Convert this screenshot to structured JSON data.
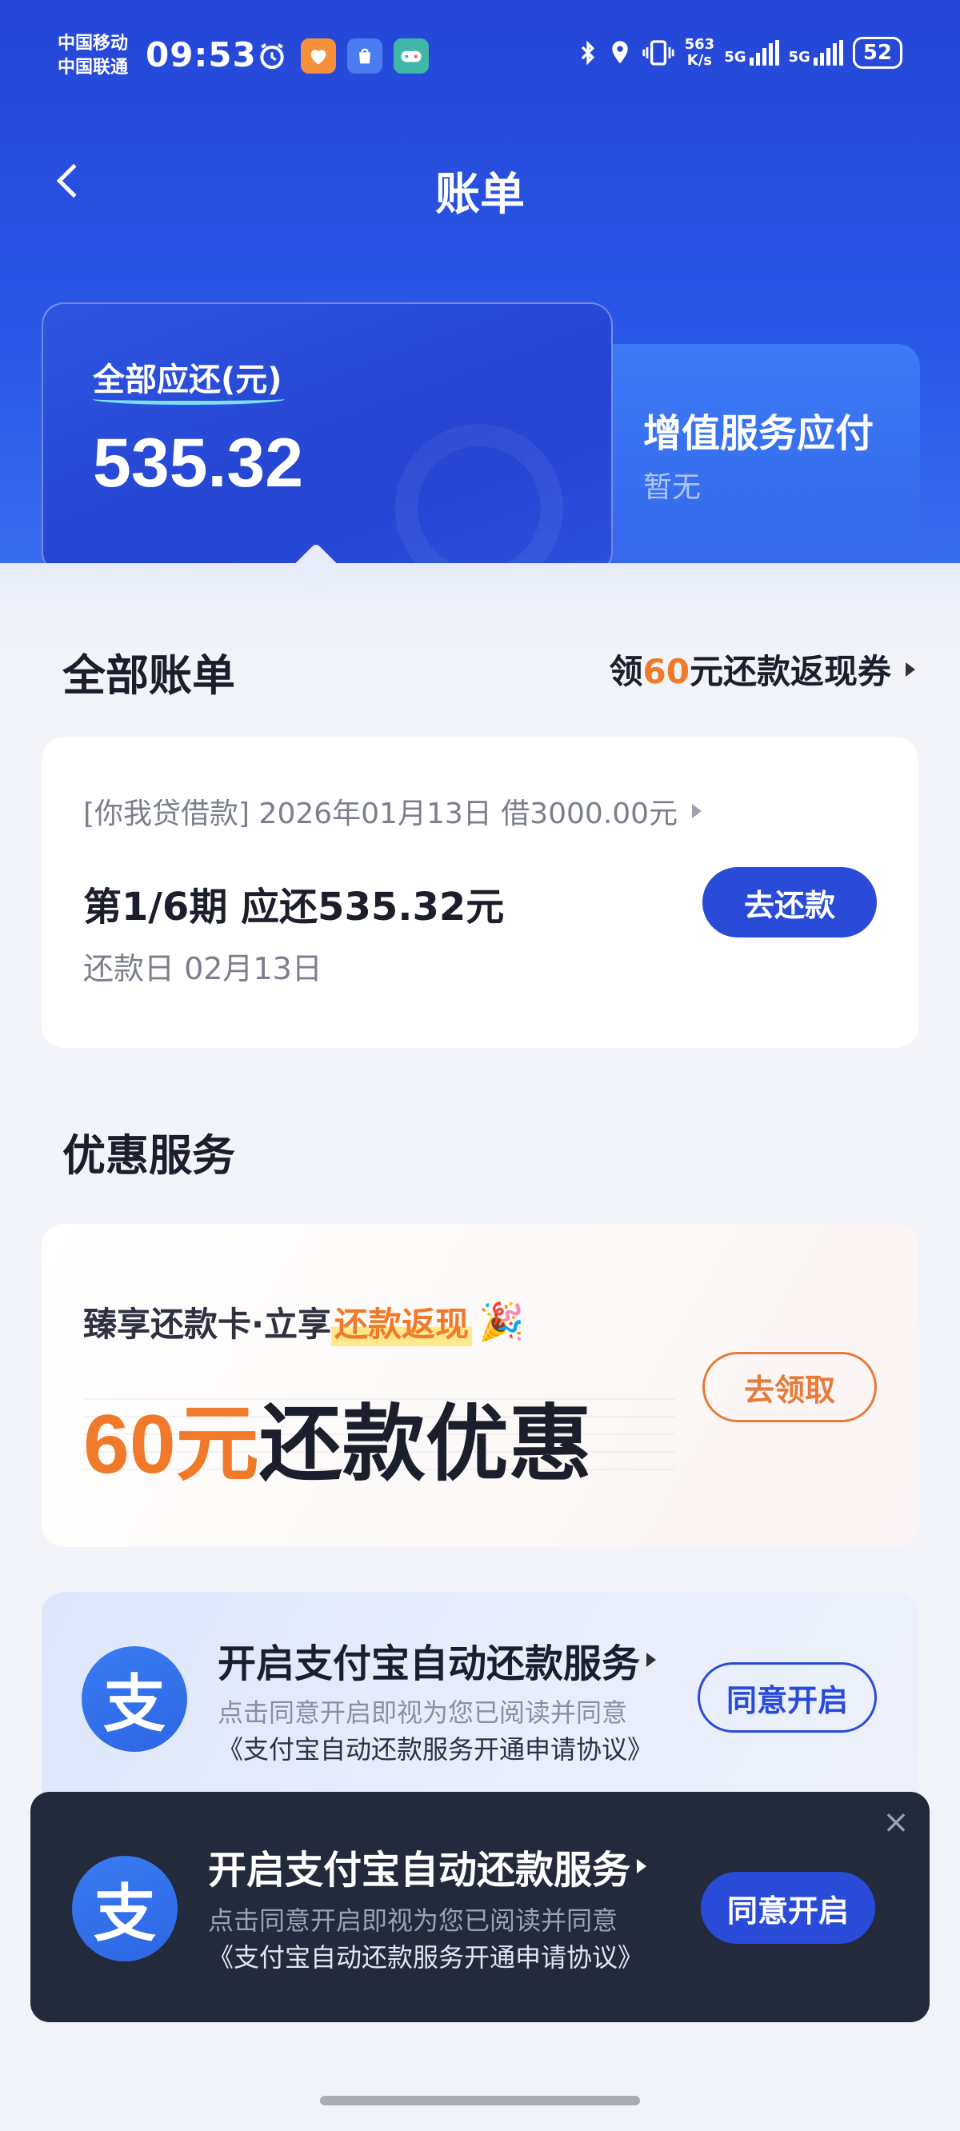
{
  "status_bar": {
    "carrier_1": "中国移动",
    "carrier_2": "中国联通",
    "time": "09:53",
    "net_speed_value": "563",
    "net_speed_unit": "K/s",
    "sig1_label": "5G",
    "sig2_label": "5G",
    "battery": "52"
  },
  "nav": {
    "title": "账单"
  },
  "summary": {
    "total_label": "全部应还(元)",
    "total_amount": "535.32",
    "vas_title": "增值服务应付",
    "vas_value": "暂无"
  },
  "bills_section": {
    "title": "全部账单",
    "promo_prefix": "领",
    "promo_amount": "60",
    "promo_suffix": "元还款返现券"
  },
  "bill": {
    "meta": "[你我贷借款] 2026年01月13日 借3000.00元",
    "period": "第1/6期 应还535.32元",
    "due_date": "还款日 02月13日",
    "repay_label": "去还款"
  },
  "discount_section": {
    "title": "优惠服务"
  },
  "discount": {
    "subtitle_prefix": "臻享还款卡·立享",
    "subtitle_highlight": "还款返现",
    "main_highlight": "60元",
    "main_text": "还款优惠",
    "claim_label": "去领取"
  },
  "alipay_card": {
    "logo_char": "支",
    "title": "开启支付宝自动还款服务",
    "desc_line1": "点击同意开启即视为您已阅读并同意",
    "desc_line2": "《支付宝自动还款服务开通申请协议》",
    "agree_label": "同意开启"
  },
  "alipay_popup": {
    "logo_char": "支",
    "title": "开启支付宝自动还款服务",
    "desc_line1": "点击同意开启即视为您已阅读并同意",
    "desc_line2": "《支付宝自动还款服务开通申请协议》",
    "agree_label": "同意开启",
    "close_glyph": "×"
  },
  "colors": {
    "brand_blue": "#2a4bd7",
    "accent_orange": "#f07a2a",
    "header_blue": "#2546d6",
    "popup_bg": "#222a3b"
  },
  "icons": {
    "back": "chevron-left-icon",
    "alarm": "alarm-icon",
    "bluetooth": "bluetooth-icon",
    "location": "location-icon",
    "vibrate": "vibrate-icon",
    "close": "close-icon",
    "party": "party-popper-icon"
  }
}
